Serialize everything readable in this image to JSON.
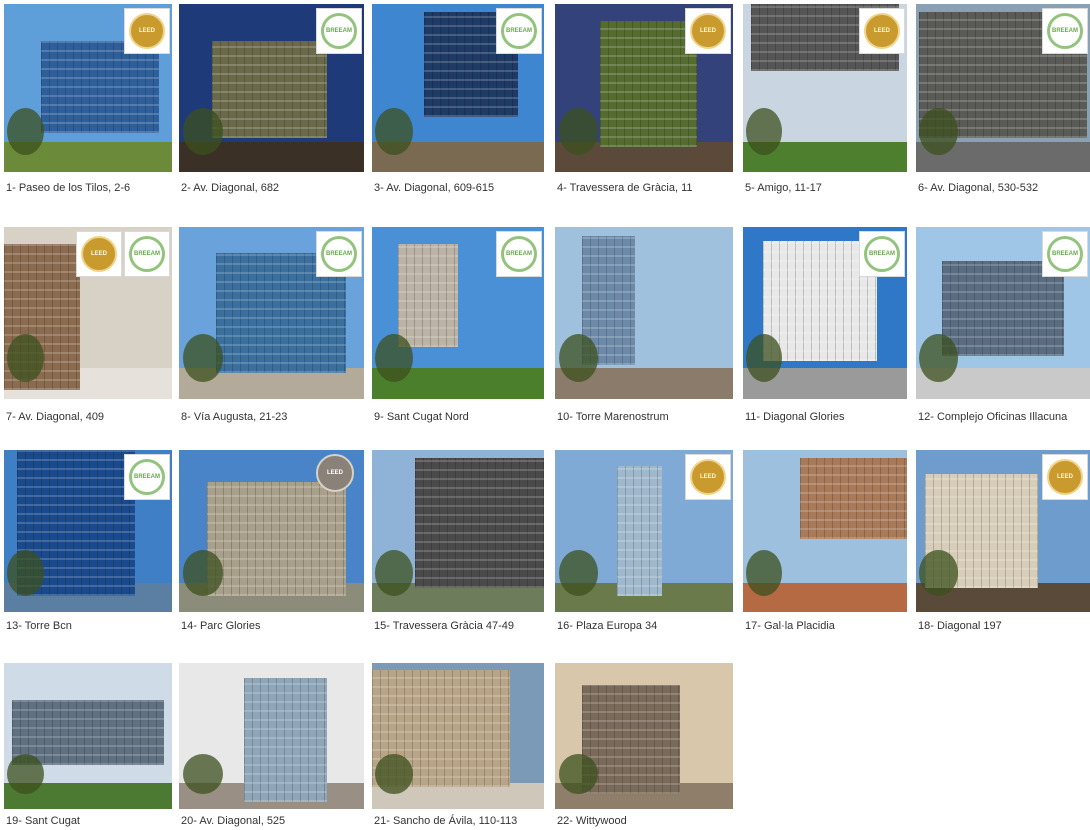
{
  "tiles": [
    {
      "caption": "1- Paseo de los Tilos, 2-6",
      "badges": [
        "leed"
      ]
    },
    {
      "caption": "2- Av. Diagonal, 682",
      "badges": [
        "breeam"
      ]
    },
    {
      "caption": "3- Av. Diagonal, 609-615",
      "badges": [
        "breeam"
      ]
    },
    {
      "caption": "4- Travessera de Gràcia, 11",
      "badges": [
        "leed"
      ]
    },
    {
      "caption": "5- Amigo, 11-17",
      "badges": [
        "leed"
      ]
    },
    {
      "caption": "6- Av. Diagonal, 530-532",
      "badges": [
        "breeam"
      ]
    },
    {
      "caption": "7- Av. Diagonal, 409",
      "badges": [
        "leed",
        "breeam"
      ]
    },
    {
      "caption": "8- Vía Augusta, 21-23",
      "badges": [
        "breeam"
      ]
    },
    {
      "caption": "9- Sant Cugat Nord",
      "badges": [
        "breeam"
      ]
    },
    {
      "caption": "10- Torre Marenostrum",
      "badges": []
    },
    {
      "caption": "11- Diagonal Glories",
      "badges": [
        "breeam"
      ]
    },
    {
      "caption": "12- Complejo Oficinas Illacuna",
      "badges": [
        "breeam"
      ]
    },
    {
      "caption": "13- Torre Bcn",
      "badges": [
        "breeam"
      ]
    },
    {
      "caption": "14- Parc Glories",
      "badges": [
        "leed2"
      ]
    },
    {
      "caption": "15- Travessera Gràcia 47-49",
      "badges": []
    },
    {
      "caption": "16- Plaza Europa 34",
      "badges": [
        "leed"
      ]
    },
    {
      "caption": "17- Gal·la Placidia",
      "badges": []
    },
    {
      "caption": "18- Diagonal 197",
      "badges": [
        "leed"
      ]
    },
    {
      "caption": "19- Sant Cugat",
      "badges": []
    },
    {
      "caption": "20- Av. Diagonal, 525",
      "badges": []
    },
    {
      "caption": "21- Sancho de Ávila, 110-113",
      "badges": []
    },
    {
      "caption": "22- Wittywood",
      "badges": []
    }
  ],
  "badge_text": {
    "leed": "LEED",
    "breeam": "BREEAM",
    "leed2": "LEED"
  }
}
